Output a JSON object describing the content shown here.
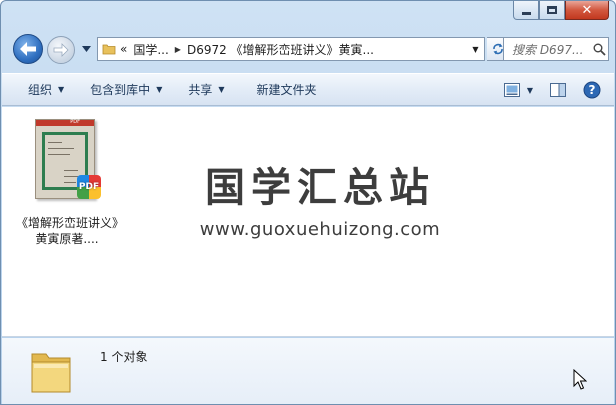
{
  "window": {
    "caption_buttons": {
      "minimize": "minimize",
      "maximize": "maximize",
      "close": "✕"
    }
  },
  "address_bar": {
    "overflow_marker": "«",
    "crumbs": [
      "国学...",
      "D6972 《增解形峦班讲义》黄寅..."
    ]
  },
  "search": {
    "placeholder": "搜索 D697..."
  },
  "toolbar": {
    "organize": "组织",
    "include_in_library": "包含到库中",
    "share": "共享",
    "new_folder": "新建文件夹"
  },
  "file": {
    "name": "《增解形峦班讲义》黄寅原著....",
    "badge": "PDF",
    "thumb_band": "PDF"
  },
  "watermark": {
    "title": "国学汇总站",
    "url": "www.guoxuehuizong.com"
  },
  "details": {
    "count_text": "1 个对象"
  },
  "colors": {
    "accent": "#1e395b",
    "window_frame": "#bcd5ee",
    "close": "#c2381f"
  }
}
